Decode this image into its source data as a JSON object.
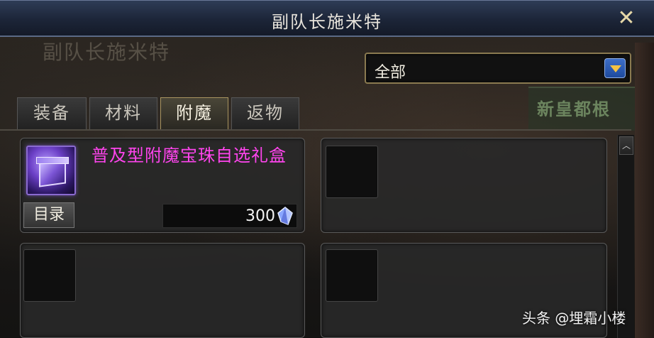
{
  "window": {
    "title": "副队长施米特",
    "close_glyph": "✕"
  },
  "background": {
    "sign_text": "副队长施米特",
    "shop_text": "新皇都根"
  },
  "filter": {
    "selected": "全部"
  },
  "tabs": [
    {
      "label": "装备",
      "active": false
    },
    {
      "label": "材料",
      "active": false
    },
    {
      "label": "附魔",
      "active": true
    },
    {
      "label": "返物",
      "active": false
    }
  ],
  "items": [
    {
      "name": "普及型附魔宝珠自选礼盒",
      "catalog_label": "目录",
      "price": "300",
      "currency_icon": "crystal-icon",
      "name_color": "#ff44ee"
    }
  ],
  "watermark": "头条 @埋霜小楼",
  "colors": {
    "accent_gold": "#a89460",
    "titlebar_blue": "#1c2538",
    "item_magenta": "#ff44ee"
  }
}
